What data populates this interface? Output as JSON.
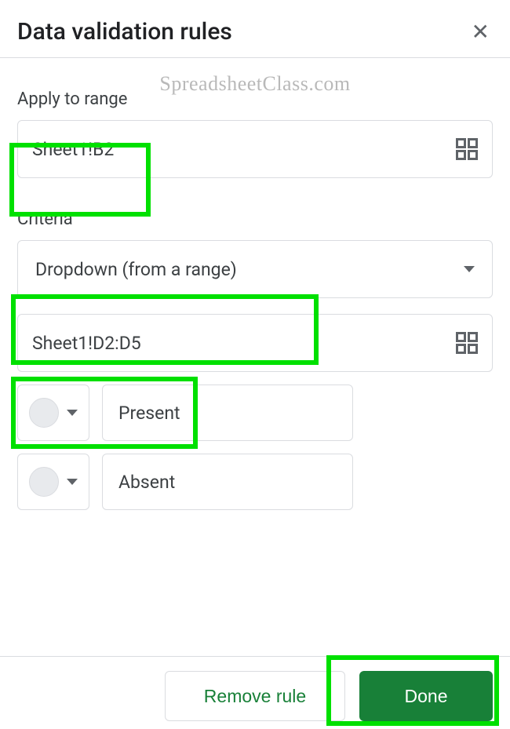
{
  "header": {
    "title": "Data validation rules"
  },
  "watermark": "SpreadsheetClass.com",
  "range": {
    "label": "Apply to range",
    "value": "Sheet1!B2"
  },
  "criteria": {
    "label": "Criteria",
    "type": "Dropdown (from a range)",
    "source": "Sheet1!D2:D5",
    "options": [
      {
        "label": "Present"
      },
      {
        "label": "Absent"
      }
    ]
  },
  "footer": {
    "remove": "Remove rule",
    "done": "Done"
  }
}
